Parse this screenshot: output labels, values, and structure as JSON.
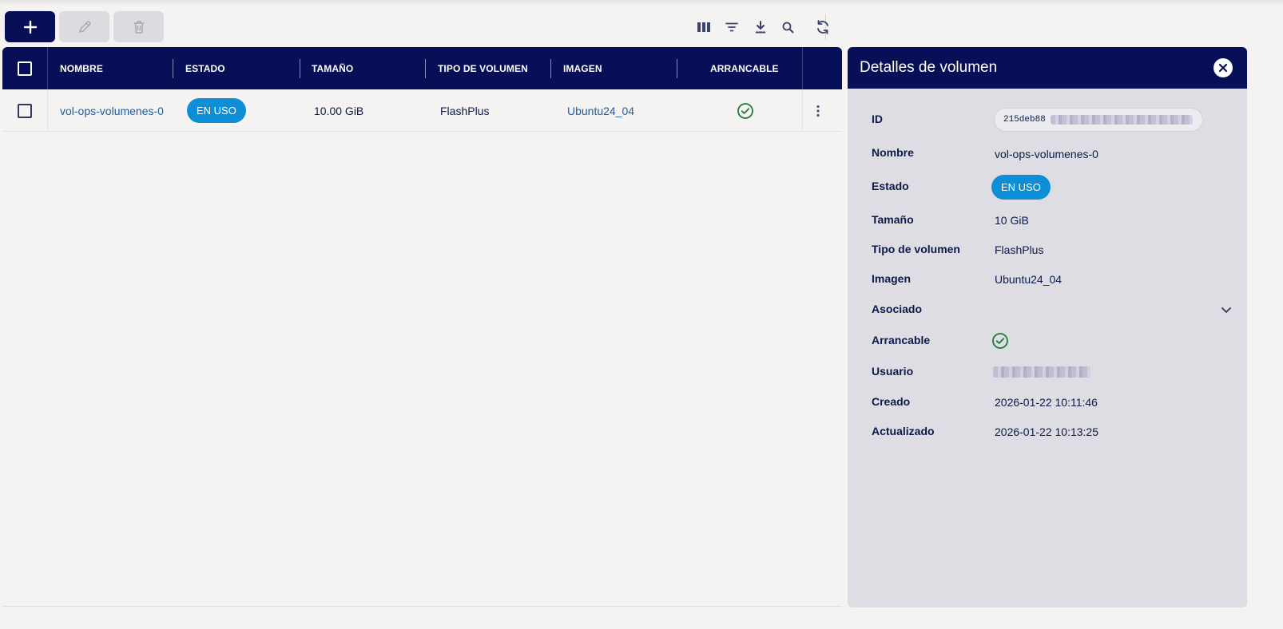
{
  "toolbar": {
    "add_icon": "plus-icon",
    "edit_icon": "pencil-icon",
    "delete_icon": "trash-icon",
    "columns_icon": "columns-icon",
    "filter_icon": "filter-icon",
    "download_icon": "download-icon",
    "search_icon": "search-icon",
    "refresh_icon": "refresh-icon"
  },
  "table": {
    "headers": {
      "name": "NOMBRE",
      "status": "ESTADO",
      "size": "TAMAÑO",
      "volume_type": "TIPO DE VOLUMEN",
      "image": "IMAGEN",
      "bootable": "ARRANCABLE"
    },
    "rows": [
      {
        "name": "vol-ops-volumenes-0",
        "status": "EN USO",
        "size": "10.00 GiB",
        "volume_type": "FlashPlus",
        "image": "Ubuntu24_04",
        "bootable": true
      }
    ]
  },
  "details": {
    "title": "Detalles de volumen",
    "labels": {
      "id": "ID",
      "name": "Nombre",
      "status": "Estado",
      "size": "Tamaño",
      "volume_type": "Tipo de volumen",
      "image": "Imagen",
      "attached": "Asociado",
      "bootable": "Arrancable",
      "user": "Usuario",
      "created": "Creado",
      "updated": "Actualizado"
    },
    "values": {
      "id_prefix": "215deb88",
      "name": "vol-ops-volumenes-0",
      "status": "EN USO",
      "size": "10 GiB",
      "volume_type": "FlashPlus",
      "image": "Ubuntu24_04",
      "created": "2026-01-22 10:11:46",
      "updated": "2026-01-22 10:13:25"
    }
  },
  "colors": {
    "primary": "#070f57",
    "badge": "#0d8fd8",
    "link": "#1c5ea3",
    "success": "#1e7a34"
  }
}
